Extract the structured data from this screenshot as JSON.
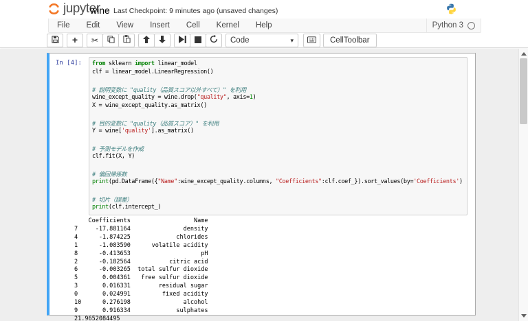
{
  "header": {
    "logo_text": "jupyter",
    "notebook_title": "wine",
    "checkpoint_text": "Last Checkpoint: 9 minutes ago (unsaved changes)"
  },
  "menubar": {
    "items": [
      "File",
      "Edit",
      "View",
      "Insert",
      "Cell",
      "Kernel",
      "Help"
    ],
    "kernel_name": "Python 3",
    "kernel_indicator_icon": "kernel-idle-circle-icon"
  },
  "toolbar": {
    "groups": [
      [
        "save-icon"
      ],
      [
        "add-cell-icon"
      ],
      [
        "cut-icon",
        "copy-icon",
        "paste-icon"
      ],
      [
        "move-up-icon",
        "move-down-icon"
      ],
      [
        "run-icon",
        "stop-icon",
        "restart-icon"
      ]
    ],
    "cell_type_value": "Code",
    "palette_icon": "keyboard-icon",
    "cell_toolbar_label": "CellToolbar"
  },
  "brand_colors": {
    "jupyter_orange": "#f37726",
    "selected_cell_blue": "#42a5f5",
    "python_blue": "#3776ab",
    "python_yellow": "#ffd43b"
  },
  "cell": {
    "prompt": "In [4]:",
    "code_lines": [
      [
        [
          "k",
          "from"
        ],
        [
          "p",
          " sklearn "
        ],
        [
          "k",
          "import"
        ],
        [
          "p",
          " linear_model"
        ]
      ],
      [
        [
          "p",
          "clf = linear_model.LinearRegression()"
        ]
      ],
      [],
      [
        [
          "c",
          "# 説明変数に \"quality（品質スコア以外すべて）\" を利用"
        ]
      ],
      [
        [
          "p",
          "wine_except_quality = wine.drop("
        ],
        [
          "s",
          "\"quality\""
        ],
        [
          "p",
          ", axis="
        ],
        [
          "n",
          "1"
        ],
        [
          "p",
          ")"
        ]
      ],
      [
        [
          "p",
          "X = wine_except_quality.as_matrix()"
        ]
      ],
      [],
      [
        [
          "c",
          "# 目的変数に \"quality（品質スコア）\" を利用"
        ]
      ],
      [
        [
          "p",
          "Y = wine["
        ],
        [
          "s",
          "'quality'"
        ],
        [
          "p",
          "].as_matrix()"
        ]
      ],
      [],
      [
        [
          "c",
          "# 予測モデルを作成"
        ]
      ],
      [
        [
          "p",
          "clf.fit(X, Y)"
        ]
      ],
      [],
      [
        [
          "c",
          "# 偏回帰係数"
        ]
      ],
      [
        [
          "b",
          "print"
        ],
        [
          "p",
          "(pd.DataFrame({"
        ],
        [
          "s",
          "\"Name\""
        ],
        [
          "p",
          ":wine_except_quality.columns, "
        ],
        [
          "s",
          "\"Coefficients\""
        ],
        [
          "p",
          ":clf.coef_}).sort_values(by="
        ],
        [
          "s",
          "'Coefficients'"
        ],
        [
          "p",
          ") )"
        ]
      ],
      [],
      [
        [
          "c",
          "# 切片（誤差）"
        ]
      ],
      [
        [
          "b",
          "print"
        ],
        [
          "p",
          "(clf.intercept_)"
        ]
      ]
    ],
    "output_text": "    Coefficients                  Name\n7     -17.881164               density\n4      -1.874225             chlorides\n1      -1.083590      volatile acidity\n8      -0.413653                    pH\n2      -0.182564           citric acid\n6      -0.003265  total sulfur dioxide\n5       0.004361   free sulfur dioxide\n3       0.016331        residual sugar\n0       0.024991         fixed acidity\n10      0.276198               alcohol\n9       0.916334             sulphates\n21.9652084495"
  }
}
